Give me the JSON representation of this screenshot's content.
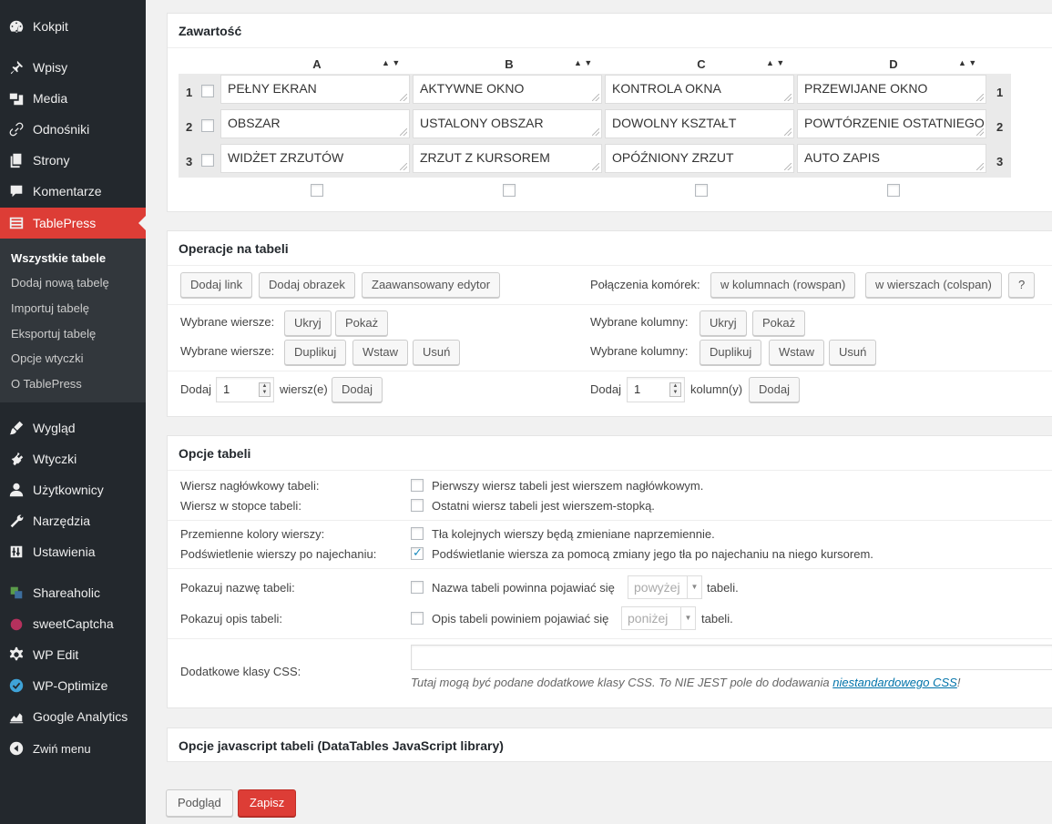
{
  "sidebar": {
    "items": [
      {
        "label": "Kokpit",
        "icon": "dashboard-icon"
      },
      {
        "label": "Wpisy",
        "icon": "pin-icon"
      },
      {
        "label": "Media",
        "icon": "media-icon"
      },
      {
        "label": "Odnośniki",
        "icon": "link-icon"
      },
      {
        "label": "Strony",
        "icon": "pages-icon"
      },
      {
        "label": "Komentarze",
        "icon": "comment-icon"
      },
      {
        "label": "TablePress",
        "icon": "table-icon"
      },
      {
        "label": "Wygląd",
        "icon": "brush-icon"
      },
      {
        "label": "Wtyczki",
        "icon": "plugin-icon"
      },
      {
        "label": "Użytkownicy",
        "icon": "user-icon"
      },
      {
        "label": "Narzędzia",
        "icon": "wrench-icon"
      },
      {
        "label": "Ustawienia",
        "icon": "settings-icon"
      },
      {
        "label": "Shareaholic",
        "icon": "shareaholic-icon"
      },
      {
        "label": "sweetCaptcha",
        "icon": "captcha-icon"
      },
      {
        "label": "WP Edit",
        "icon": "gear-icon"
      },
      {
        "label": "WP-Optimize",
        "icon": "check-circle-icon"
      },
      {
        "label": "Google Analytics",
        "icon": "analytics-icon"
      },
      {
        "label": "Zwiń menu",
        "icon": "collapse-icon"
      }
    ],
    "submenu": [
      "Wszystkie tabele",
      "Dodaj nową tabelę",
      "Importuj tabelę",
      "Eksportuj tabelę",
      "Opcje wtyczki",
      "O TablePress"
    ]
  },
  "content": {
    "title": "Zawartość",
    "columns": [
      "A",
      "B",
      "C",
      "D"
    ],
    "row_numbers": [
      "1",
      "2",
      "3"
    ],
    "rows": [
      [
        "PEŁNY EKRAN",
        "AKTYWNE OKNO",
        "KONTROLA OKNA",
        "PRZEWIJANE OKNO"
      ],
      [
        "OBSZAR",
        "USTALONY OBSZAR",
        "DOWOLNY KSZTAŁT",
        "POWTÓRZENIE OSTATNIEGO ZRZUTU"
      ],
      [
        "WIDŻET ZRZUTÓW",
        "ZRZUT Z KURSOREM",
        "OPÓŹNIONY ZRZUT",
        "AUTO ZAPIS"
      ]
    ]
  },
  "operations": {
    "title": "Operacje na tabeli",
    "insert_link": "Dodaj link",
    "insert_image": "Dodaj obrazek",
    "advanced_editor": "Zaawansowany edytor",
    "merge_label": "Połączenia komórek:",
    "merge_rowspan": "w kolumnach (rowspan)",
    "merge_colspan": "w wierszach (colspan)",
    "help": "?",
    "selected_rows": "Wybrane wiersze:",
    "selected_cols": "Wybrane kolumny:",
    "hide": "Ukryj",
    "show": "Pokaż",
    "duplicate": "Duplikuj",
    "insert": "Wstaw",
    "remove": "Usuń",
    "add": "Dodaj",
    "rows_value": "1",
    "rows_suffix": "wiersz(e)",
    "cols_value": "1",
    "cols_suffix": "kolumn(y)"
  },
  "options": {
    "title": "Opcje tabeli",
    "header_row_label": "Wiersz nagłówkowy tabeli:",
    "header_row_text": "Pierwszy wiersz tabeli jest wierszem nagłówkowym.",
    "footer_row_label": "Wiersz w stopce tabeli:",
    "footer_row_text": "Ostatni wiersz tabeli jest wierszem-stopką.",
    "alt_colors_label": "Przemienne kolory wierszy:",
    "alt_colors_text": "Tła kolejnych wierszy będą zmieniane naprzemiennie.",
    "hover_label": "Podświetlenie wierszy po najechaniu:",
    "hover_text": "Podświetlanie wiersza za pomocą zmiany jego tła po najechaniu na niego kursorem.",
    "show_name_label": "Pokazuj nazwę tabeli:",
    "show_name_text": "Nazwa tabeli powinna pojawiać się",
    "show_name_select": "powyżej",
    "show_name_suffix": "tabeli.",
    "show_desc_label": "Pokazuj opis tabeli:",
    "show_desc_text": "Opis tabeli powiniem pojawiać się",
    "show_desc_select": "poniżej",
    "show_desc_suffix": "tabeli.",
    "css_label": "Dodatkowe klasy CSS:",
    "css_value": "",
    "css_help_pre": "Tutaj mogą być podane dodatkowe klasy CSS. To NIE JEST pole do dodawania ",
    "css_help_link": "niestandardowego CSS",
    "css_help_post": "!"
  },
  "js_options": {
    "title": "Opcje javascript tabeli (DataTables JavaScript library)"
  },
  "footer": {
    "preview": "Podgląd",
    "save": "Zapisz"
  }
}
